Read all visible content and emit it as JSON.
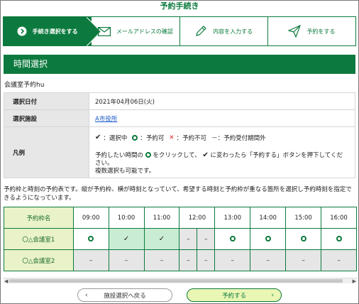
{
  "page_title": "予約手続き",
  "steps": [
    {
      "label": "手続き選択をする",
      "icon": "arrow-circle-icon",
      "active": true
    },
    {
      "label": "メールアドレスの確認",
      "icon": "envelope-icon",
      "active": false
    },
    {
      "label": "内容を入力する",
      "icon": "pencil-icon",
      "active": false
    },
    {
      "label": "予約をする",
      "icon": "paper-plane-icon",
      "active": false
    }
  ],
  "section_title": "時間選択",
  "room_name": "会議室予約hu",
  "info": {
    "date_label": "選択日付",
    "date_value": "2021年04月06日(火)",
    "facility_label": "選択施設",
    "facility_value": "A市役所",
    "legend_label": "凡例",
    "legend_selected": "：選択中",
    "legend_available": "：予約可",
    "legend_unavailable": "：予約不可",
    "legend_outside": "－：予約受付期間外",
    "legend_help_1": "予約したい時間の",
    "legend_help_2": "をクリックして、",
    "legend_help_3": "に変わったら「予約する」ボタンを押下してください。",
    "legend_help_4": "複数選択も可能です。"
  },
  "description": "予約枠と時刻の予約表です。縦が予約枠、横が時刻となっていて、希望する時刻と予約枠が重なる箇所を選択し予約時刻を指定できるようになっています。",
  "grid": {
    "corner": "予約枠名",
    "times": [
      "09:00",
      "10:00",
      "11:00",
      "12:00",
      "13:00",
      "14:00",
      "15:00",
      "16:00"
    ],
    "rows": [
      {
        "name": "〇△会議室1",
        "cells": [
          "○",
          "✓",
          "✓",
          "–",
          "–",
          "○",
          "○",
          "○",
          "○"
        ]
      },
      {
        "name": "〇△会議室2",
        "cells": [
          "–",
          "–",
          "–",
          "–",
          "–",
          "–",
          "–",
          "–",
          "–"
        ]
      }
    ]
  },
  "buttons": {
    "back": "施設選択へ戻る",
    "next": "予約する"
  },
  "colors": {
    "accent": "#0c7a3e",
    "selected": "#c8ecd4",
    "unavailable_cell": "#e6e6e6",
    "row_header": "#e9f2c8",
    "cross": "#d81f1f",
    "link": "#1a56c8"
  }
}
